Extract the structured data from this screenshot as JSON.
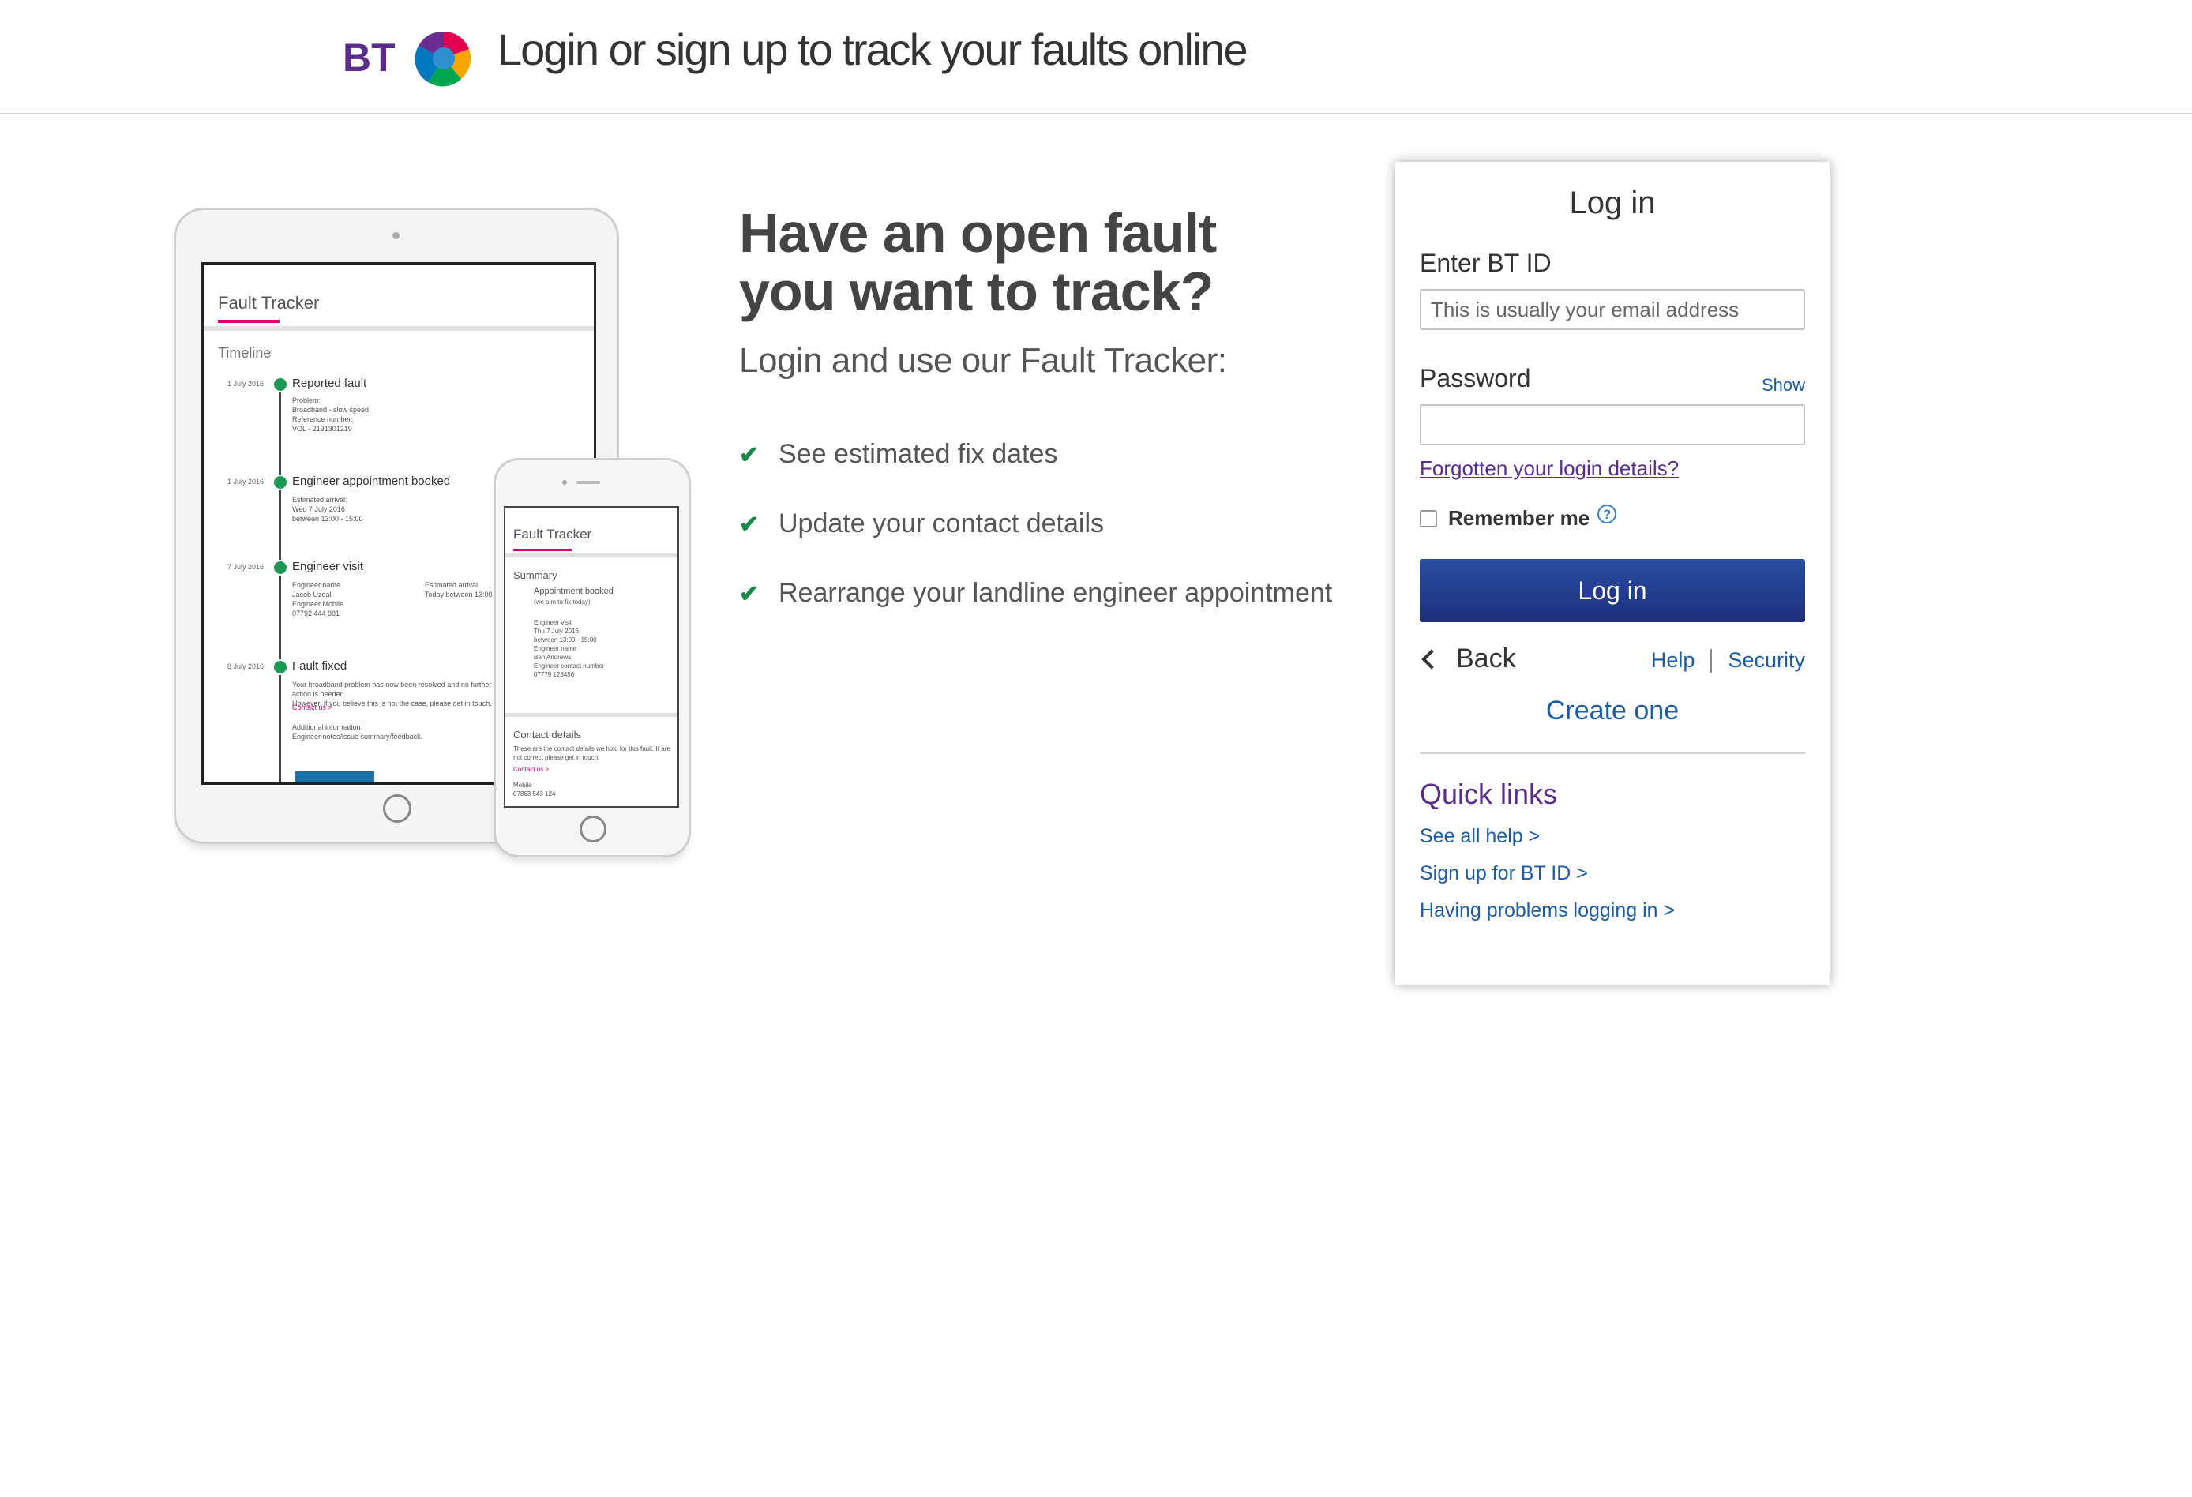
{
  "header": {
    "logo_text": "BT",
    "title": "Login or sign up to track your faults online"
  },
  "illustration": {
    "tablet": {
      "title": "Fault Tracker",
      "subtitle": "Timeline",
      "timeline": [
        {
          "date": "1 July 2016",
          "heading": "Reported fault",
          "lines": [
            "Problem:",
            "Broadband - slow speed",
            "Reference number:",
            "VOL - 2191301219"
          ]
        },
        {
          "date": "1 July 2016",
          "heading": "Engineer appointment booked",
          "lines": [
            "Estimated arrival:",
            "Wed 7 July 2016",
            "between 13:00 - 15:00"
          ]
        },
        {
          "date": "7 July 2016",
          "heading": "Engineer visit",
          "lines": [
            "Engineer name",
            "Jacob Uzoall",
            "Engineer Mobile",
            "07792 444 881"
          ]
        },
        {
          "date": "8 July 2016",
          "heading": "Fault fixed",
          "lines": [
            "Your broadband problem has now been resolved and no further action is needed.",
            "However, if you believe this is not the case, please get in touch."
          ],
          "link": "Contact us >",
          "extra": [
            "Additional information:",
            "Engineer notes/issue summary/feedback."
          ]
        }
      ],
      "side_label": "Estimated arrival",
      "side_value": "Today between 13:00"
    },
    "phone": {
      "title": "Fault Tracker",
      "summary": "Summary",
      "appointment": "Appointment booked",
      "appointment_note": "(we aim to fix today)",
      "details": [
        "Engineer visit",
        "Thu 7 July 2016",
        "between 13:00 - 15:00",
        "Engineer name",
        "Ben Andrews",
        "Engineer contact number",
        "07779 123456"
      ],
      "contact_title": "Contact details",
      "contact_text": "These are the contact details we hold for this fault. If are not correct please get in touch.",
      "contact_link": "Contact us >",
      "mobile_label": "Mobile",
      "mobile_value": "07863 543 124"
    }
  },
  "promo": {
    "heading": "Have an open fault you want to track?",
    "subheading": "Login and use our Fault Tracker:",
    "features": [
      "See estimated fix dates",
      "Update your contact details",
      "Rearrange your landline engineer appointment"
    ]
  },
  "login": {
    "title": "Log in",
    "btid_label": "Enter BT ID",
    "btid_placeholder": "This is usually your email address",
    "password_label": "Password",
    "show_label": "Show",
    "forgot_label": "Forgotten your login details?",
    "remember_label": "Remember me",
    "submit_label": "Log in",
    "back_label": "Back",
    "help_label": "Help",
    "security_label": "Security",
    "create_label": "Create one",
    "quick_links_title": "Quick links",
    "quick_links": [
      "See all help >",
      "Sign up for BT ID >",
      "Having problems logging in >"
    ]
  },
  "colors": {
    "button_top": "#2b4ea2",
    "button_bottom": "#1c2f7c",
    "link_blue": "#1a5ca8",
    "link_purple": "#5a2d8c",
    "check_green": "#1a8a4a",
    "tracker_pink": "#d6006e"
  },
  "icons": [
    "bt-logo-icon",
    "check-icon",
    "help-question-icon",
    "chevron-left-icon"
  ]
}
